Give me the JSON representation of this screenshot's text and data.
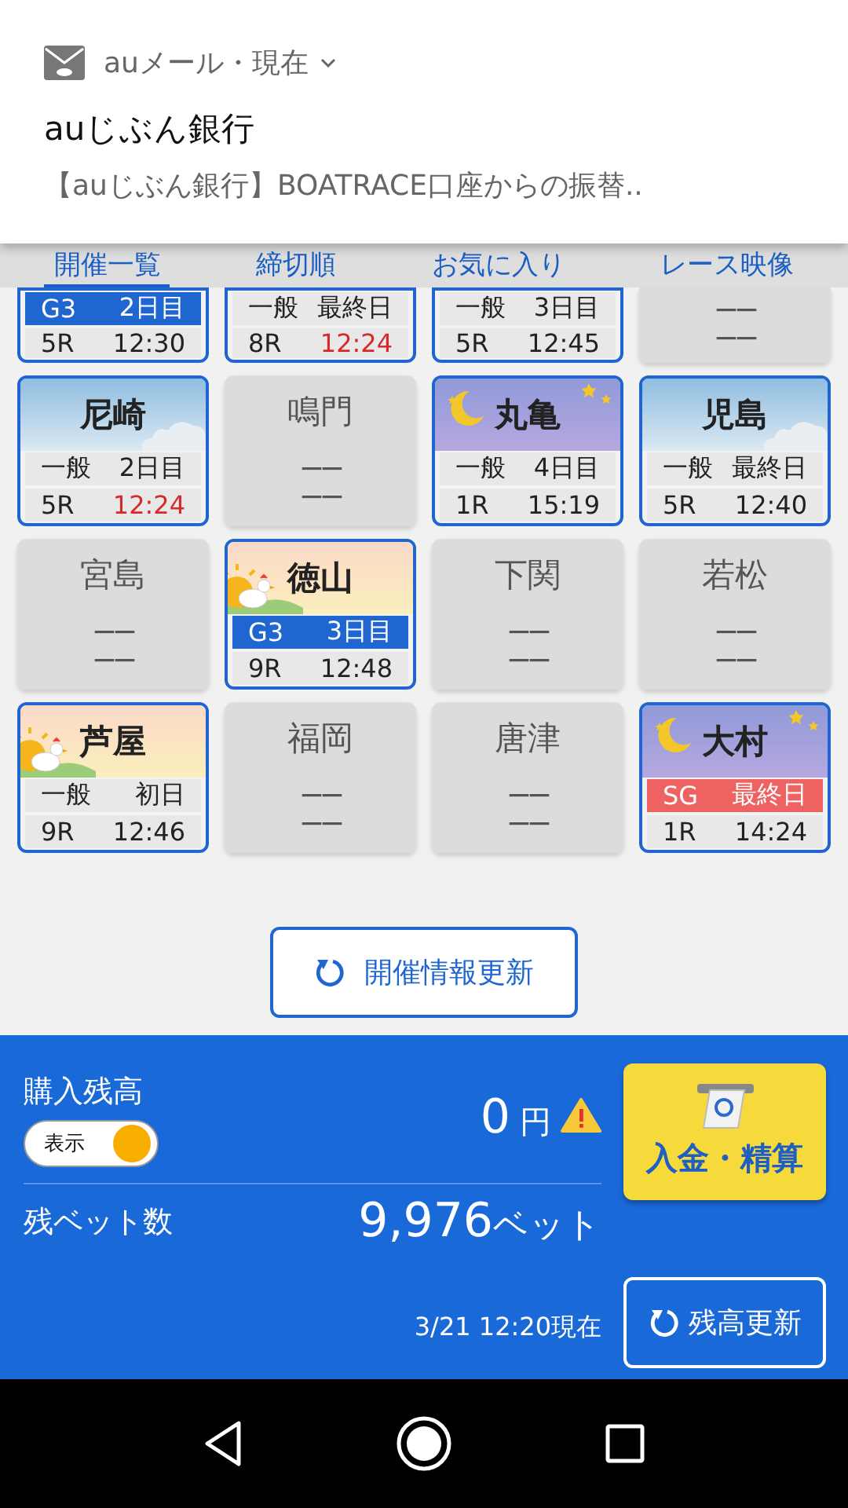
{
  "notification": {
    "app": "auメール・現在",
    "title": "auじぶん銀行",
    "body": "【auじぶん銀行】BOATRACE口座からの振替.."
  },
  "tabs": [
    {
      "label": "開催一覧",
      "selected": true
    },
    {
      "label": "締切順",
      "selected": false
    },
    {
      "label": "お気に入り",
      "selected": false
    },
    {
      "label": "レース映像",
      "selected": false
    }
  ],
  "venues": [
    {
      "kind": "partial",
      "color": "#1f66d1",
      "grade": "G3",
      "day": "2日目",
      "race": "5R",
      "time": "12:30",
      "time_alert": false
    },
    {
      "kind": "partial",
      "grade": "一般",
      "day": "最終日",
      "race": "8R",
      "time": "12:24",
      "time_alert": true
    },
    {
      "kind": "partial",
      "grade": "一般",
      "day": "3日目",
      "race": "5R",
      "time": "12:45",
      "time_alert": false
    },
    {
      "kind": "closed-partial",
      "line1": "ーー",
      "line2": "ーー"
    },
    {
      "kind": "sky",
      "name": "尼崎",
      "grade": "一般",
      "day": "2日目",
      "race": "5R",
      "time": "12:24",
      "time_alert": true
    },
    {
      "kind": "closed",
      "name": "鳴門",
      "line1": "ーー",
      "line2": "ーー"
    },
    {
      "kind": "night",
      "name": "丸亀",
      "grade": "一般",
      "day": "4日目",
      "race": "1R",
      "time": "15:19",
      "time_alert": false
    },
    {
      "kind": "sky",
      "name": "児島",
      "grade": "一般",
      "day": "最終日",
      "race": "5R",
      "time": "12:40",
      "time_alert": false
    },
    {
      "kind": "closed",
      "name": "宮島",
      "line1": "ーー",
      "line2": "ーー"
    },
    {
      "kind": "morning",
      "name": "徳山",
      "color": "#1f66d1",
      "grade": "G3",
      "day": "3日目",
      "race": "9R",
      "time": "12:48",
      "time_alert": false
    },
    {
      "kind": "closed",
      "name": "下関",
      "line1": "ーー",
      "line2": "ーー"
    },
    {
      "kind": "closed",
      "name": "若松",
      "line1": "ーー",
      "line2": "ーー"
    },
    {
      "kind": "morning",
      "name": "芦屋",
      "grade": "一般",
      "day": "初日",
      "race": "9R",
      "time": "12:46",
      "time_alert": false
    },
    {
      "kind": "closed",
      "name": "福岡",
      "line1": "ーー",
      "line2": "ーー"
    },
    {
      "kind": "closed",
      "name": "唐津",
      "line1": "ーー",
      "line2": "ーー"
    },
    {
      "kind": "night",
      "name": "大村",
      "color": "#ef6262",
      "grade": "SG",
      "day": "最終日",
      "race": "1R",
      "time": "14:24",
      "time_alert": false
    }
  ],
  "refresh_button": "開催情報更新",
  "balance": {
    "label": "購入残高",
    "toggle": {
      "label": "表示",
      "on": true
    },
    "amount": "0",
    "unit": "円",
    "warning": true,
    "deposit_button": "入金・精算",
    "bets_label": "残ベット数",
    "bets_count": "9,976",
    "bets_unit": "ベット",
    "updated": "3/21 12:20現在",
    "update_button": "残高更新"
  }
}
